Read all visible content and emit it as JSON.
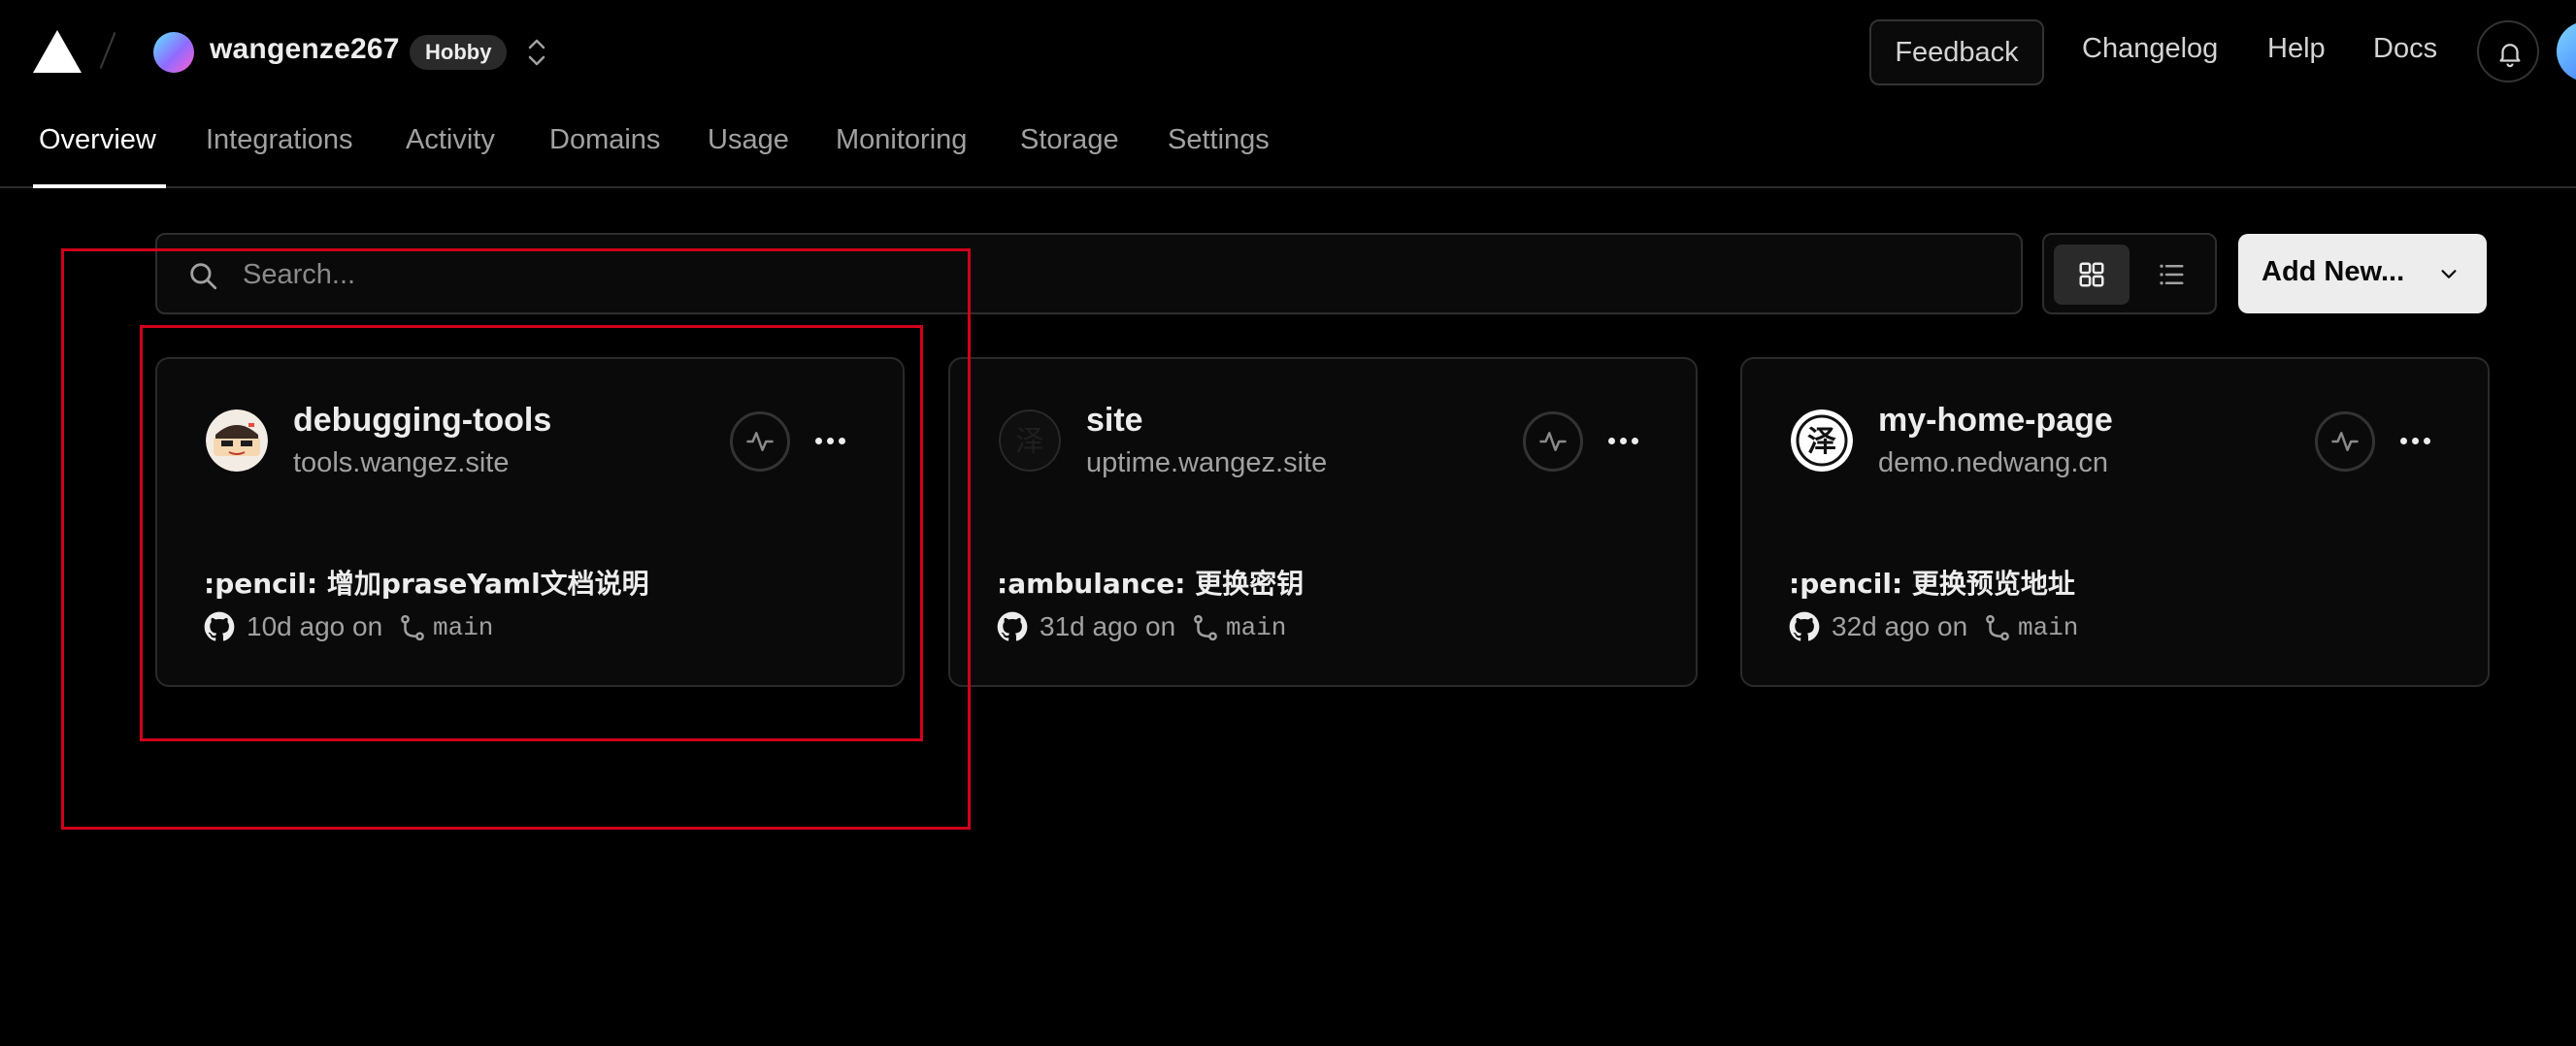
{
  "header": {
    "team_name": "wangenze267",
    "plan_badge": "Hobby",
    "feedback_label": "Feedback",
    "links": [
      "Changelog",
      "Help",
      "Docs"
    ]
  },
  "tabs": [
    "Overview",
    "Integrations",
    "Activity",
    "Domains",
    "Usage",
    "Monitoring",
    "Storage",
    "Settings"
  ],
  "active_tab": "Overview",
  "toolbar": {
    "search_placeholder": "Search...",
    "view_mode": "grid",
    "add_new_label": "Add New..."
  },
  "projects": [
    {
      "name": "debugging-tools",
      "domain": "tools.wangez.site",
      "commit_message": ":pencil: 增加praseYaml文档说明",
      "ago": "10d ago on",
      "branch": "main",
      "icon": "illustrated-avatar"
    },
    {
      "name": "site",
      "domain": "uptime.wangez.site",
      "commit_message": ":ambulance: 更换密钥",
      "ago": "31d ago on",
      "branch": "main",
      "icon": "ze-seal-dark",
      "icon_glyph": "泽"
    },
    {
      "name": "my-home-page",
      "domain": "demo.nedwang.cn",
      "commit_message": ":pencil: 更换预览地址",
      "ago": "32d ago on",
      "branch": "main",
      "icon": "ze-seal-light",
      "icon_glyph": "泽"
    }
  ],
  "colors": {
    "background": "#000000",
    "card": "#0a0a0a",
    "border": "#2a2a2a",
    "annotation": "#d0021b",
    "primary_button": "#ededed"
  }
}
